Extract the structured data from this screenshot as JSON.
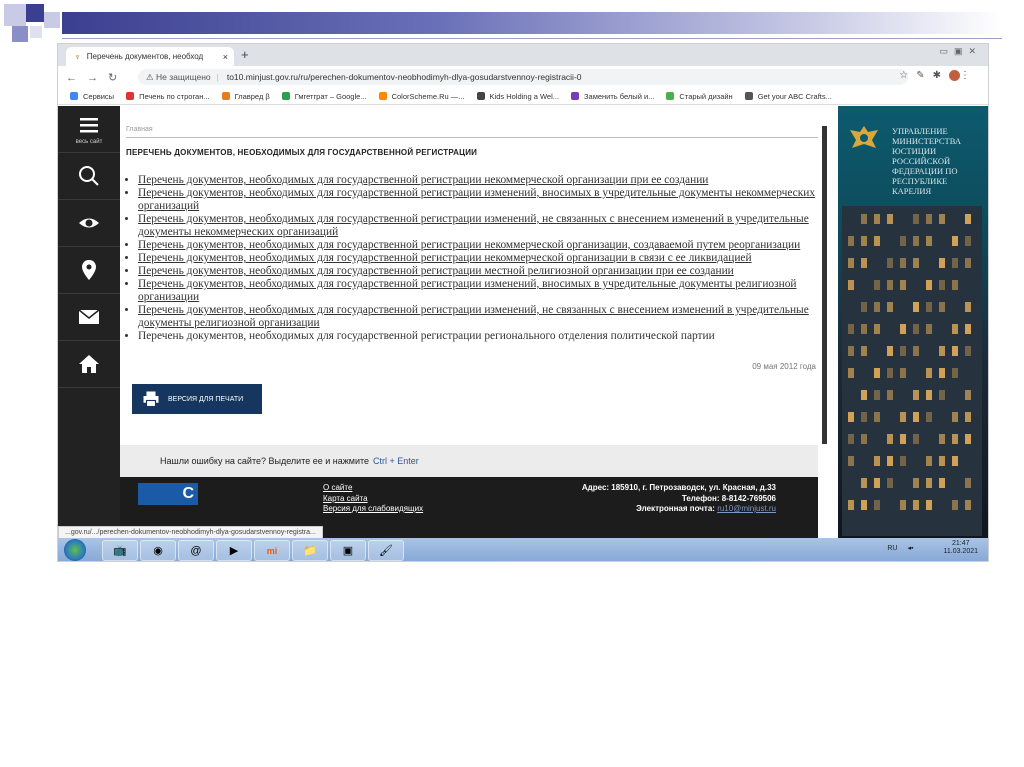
{
  "browser": {
    "tab_title": "Перечень документов, необход",
    "close_glyph": "×",
    "new_tab_glyph": "+",
    "security_warning": "Не защищено",
    "url": "to10.minjust.gov.ru/ru/perechen-dokumentov-neobhodimyh-dlya-gosudarstvennoy-registracii-0",
    "status_url": "...gov.ru/.../perechen-dokumentov-neobhodimyh-dlya-gosudarstvennoy-registra..."
  },
  "bookmarks": [
    {
      "label": "Сервисы",
      "color": "#4285f4"
    },
    {
      "label": "Печень по строган...",
      "color": "#d33"
    },
    {
      "label": "Главред β",
      "color": "#e87b20"
    },
    {
      "label": "Гмгетграт – Google...",
      "color": "#2aa14a"
    },
    {
      "label": "ColorScheme.Ru —...",
      "color": "#ff8800"
    },
    {
      "label": "Kids Holding a Wel...",
      "color": "#444"
    },
    {
      "label": "Заменить белый и...",
      "color": "#7a3db8"
    },
    {
      "label": "Старый дизайн",
      "color": "#4cae4c"
    },
    {
      "label": "Get your ABC Crafts...",
      "color": "#555"
    }
  ],
  "sidebar": {
    "menu_label": "весь сайт"
  },
  "page": {
    "breadcrumb": "Главная",
    "title": "ПЕРЕЧЕНЬ ДОКУМЕНТОВ, НЕОБХОДИМЫХ ДЛЯ ГОСУДАРСТВЕННОЙ РЕГИСТРАЦИИ",
    "documents": [
      "Перечень документов, необходимых для государственной регистрации некоммерческой организации при ее создании",
      "Перечень документов, необходимых для государственной регистрации изменений, вносимых в учредительные документы некоммерческих организаций",
      "Перечень документов, необходимых для государственной регистрации изменений, не связанных с внесением изменений в учредительные документы некоммерческих организаций",
      "Перечень документов, необходимых для государственной регистрации некоммерческой организации, создаваемой путем реорганизации",
      "Перечень документов, необходимых для государственной регистрации некоммерческой организации в связи с ее ликвидацией",
      "Перечень документов, необходимых для государственной регистрации местной религиозной организации при ее создании",
      "Перечень документов, необходимых для государственной регистрации изменений, вносимых в учредительные документы религиозной организации",
      "Перечень документов, необходимых для государственной регистрации изменений, не связанных с внесением изменений в учредительные документы религиозной организации",
      "Перечень документов, необходимых для государственной регистрации регионального отделения политической партии"
    ],
    "date": "09 мая 2012 года",
    "print_button": "ВЕРСИЯ ДЛЯ ПЕЧАТИ",
    "error_prompt": "Нашли ошибку на сайте? Выделите ее и нажмите",
    "error_keys": "Ctrl + Enter"
  },
  "footer": {
    "links": [
      "О сайте",
      "Карта сайта",
      "Версия для слабовидящих"
    ],
    "address": "Адрес: 185910, г. Петрозаводск, ул. Красная, д.33",
    "phone": "Телефон: 8-8142-769506",
    "email_label": "Электронная почта:",
    "email": "ru10@minjust.ru"
  },
  "banner": {
    "text": "Управление Министерства юстиции Российской Федерации по Республике Карелия"
  },
  "taskbar": {
    "language": "RU",
    "time": "21:47",
    "date": "11.03.2021"
  }
}
